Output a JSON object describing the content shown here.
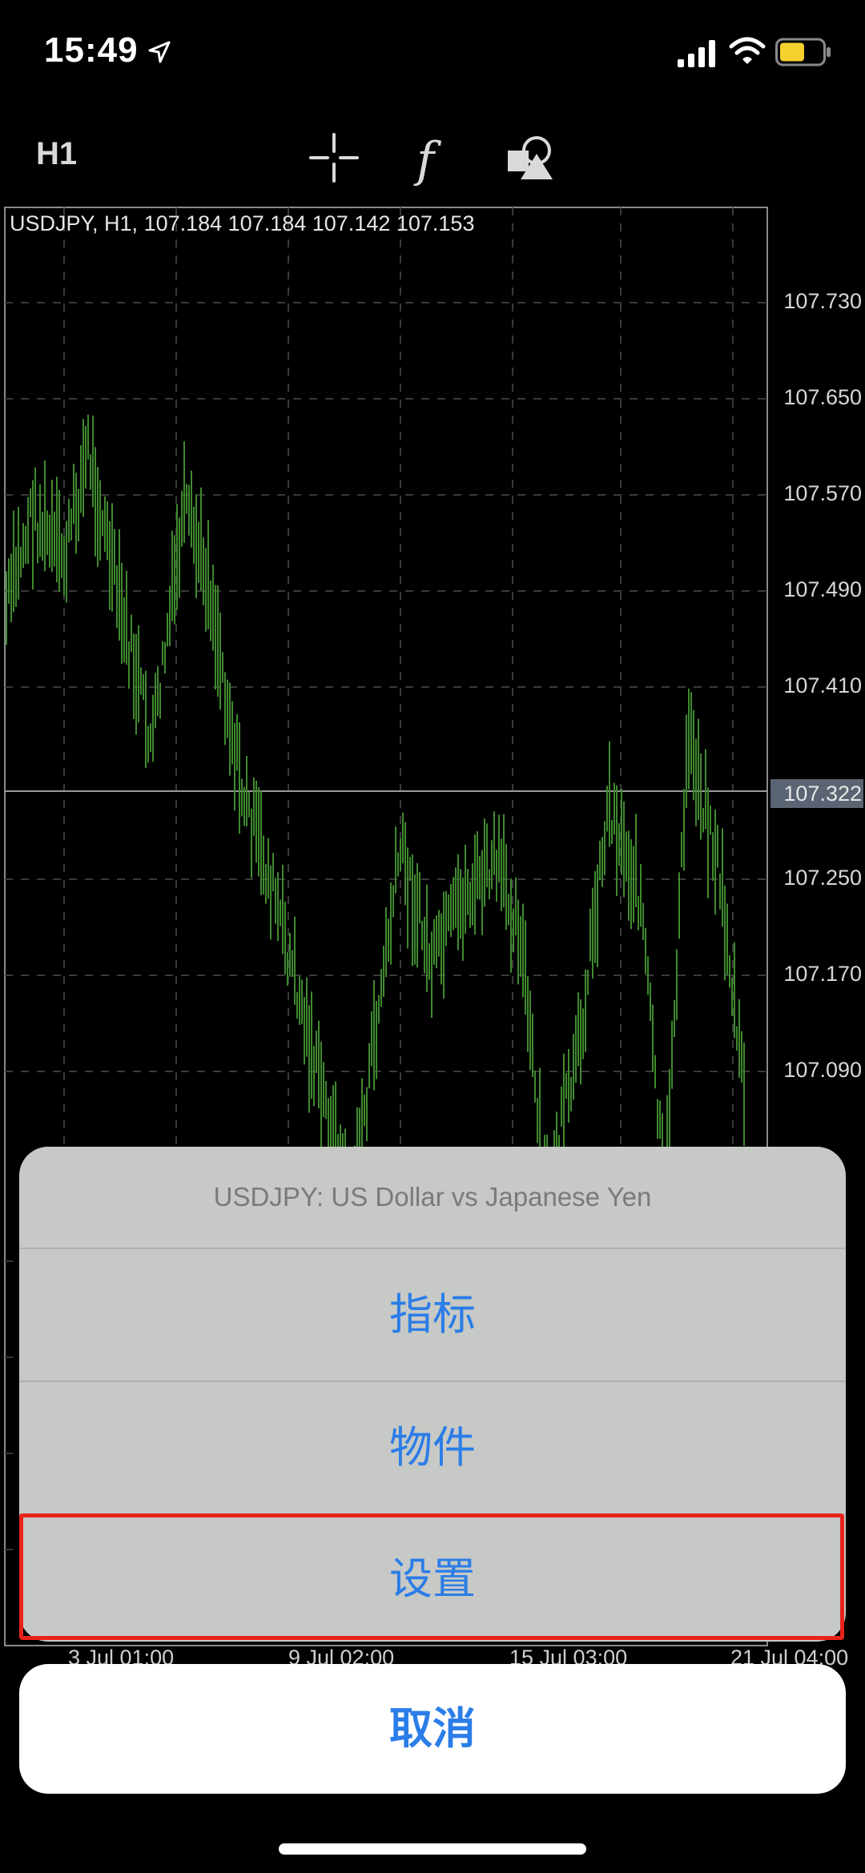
{
  "status": {
    "time": "15:49",
    "icons": [
      "location-arrow-icon",
      "signal-icon",
      "wifi-icon",
      "battery-icon"
    ],
    "battery_color": "#f5d130"
  },
  "toolbar": {
    "timeframe": "H1",
    "icons": [
      "crosshair-icon",
      "function-icon",
      "shapes-icon"
    ]
  },
  "chart": {
    "title": "USDJPY, H1, 107.184 107.184 107.142 107.153",
    "price_labels": [
      "107.730",
      "107.650",
      "107.570",
      "107.490",
      "107.410",
      "107.250",
      "107.170",
      "107.090"
    ],
    "current_price": "107.322",
    "date_labels": [
      "3 Jul 01:00",
      "9 Jul 02:00",
      "15 Jul 03:00",
      "21 Jul 04:00"
    ],
    "candle_color": "#3f8a2e"
  },
  "sheet": {
    "header": "USDJPY: US Dollar vs Japanese Yen",
    "items": [
      "指标",
      "物件",
      "设置"
    ],
    "cancel": "取消"
  }
}
